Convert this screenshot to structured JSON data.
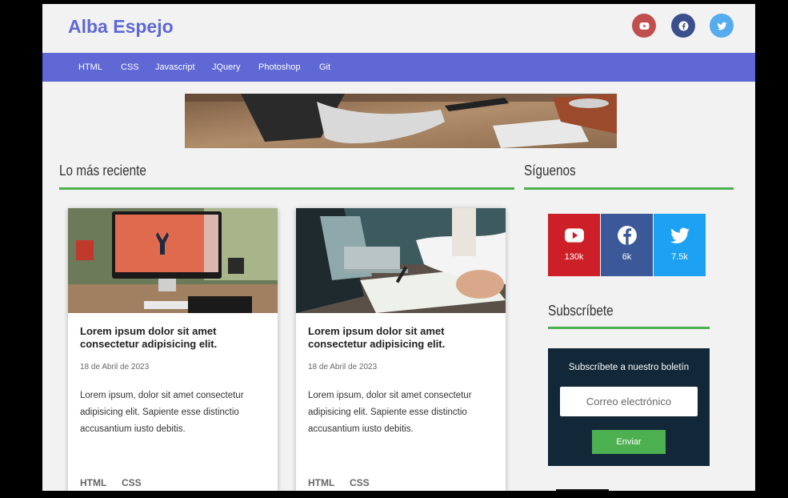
{
  "header": {
    "logo": "Alba Espejo"
  },
  "social_top": [
    {
      "icon": "youtube-icon",
      "color": "#c0504d"
    },
    {
      "icon": "facebook-icon",
      "color": "#3b4f8c"
    },
    {
      "icon": "twitter-icon",
      "color": "#55acee"
    }
  ],
  "nav": {
    "items": [
      "HTML",
      "CSS",
      "Javascript",
      "JQuery",
      "Photoshop",
      "Git"
    ]
  },
  "main": {
    "section_title": "Lo más reciente",
    "cards": [
      {
        "title": "Lorem ipsum dolor sit amet consectetur adipisicing elit.",
        "date": "18 de Abril de 2023",
        "text": "Lorem ipsum, dolor sit amet consectetur adipisicing elit. Sapiente esse distinctio accusantium iusto debitis.",
        "tags": [
          "HTML",
          "CSS"
        ]
      },
      {
        "title": "Lorem ipsum dolor sit amet consectetur adipisicing elit.",
        "date": "18 de Abril de 2023",
        "text": "Lorem ipsum, dolor sit amet consectetur adipisicing elit. Sapiente esse distinctio accusantium iusto debitis.",
        "tags": [
          "HTML",
          "CSS"
        ]
      }
    ]
  },
  "sidebar": {
    "follow_title": "Síguenos",
    "social": [
      {
        "icon": "youtube-icon",
        "count": "130k",
        "color": "#cc1f27"
      },
      {
        "icon": "facebook-icon",
        "count": "6k",
        "color": "#3b5998"
      },
      {
        "icon": "twitter-icon",
        "count": "7.5k",
        "color": "#1da1f2"
      }
    ],
    "subscribe_title": "Subscríbete",
    "newsletter": {
      "heading": "Subscríbete a nuestro boletín",
      "placeholder": "Correo electrónico",
      "button": "Enviar"
    }
  },
  "colors": {
    "accent": "#5f68d4",
    "green": "#4caf50",
    "dark": "#122838"
  }
}
